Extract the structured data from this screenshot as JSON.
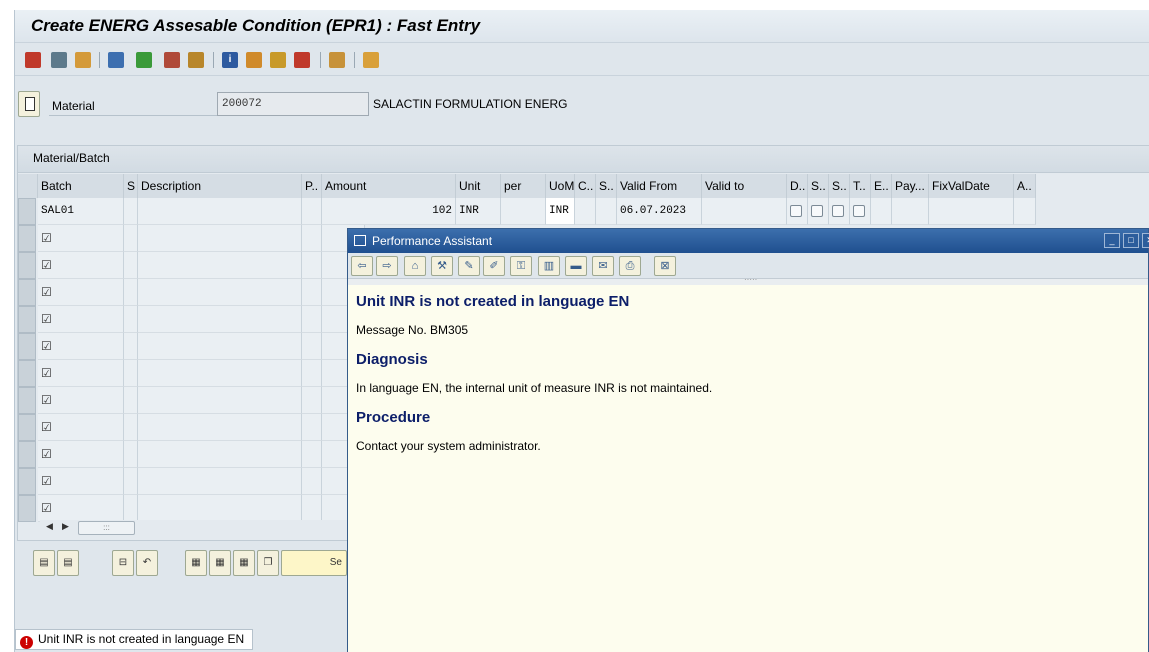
{
  "window": {
    "title": "Create ENERG Assesable Condition (EPR1) : Fast Entry"
  },
  "toolbar": {
    "icons": [
      "print-icon",
      "find-icon",
      "find-next-icon",
      "copy-icon",
      "execute-icon",
      "select-icon",
      "gift-icon",
      "info-icon",
      "hierarchy-icon",
      "key-icon",
      "delete-icon",
      "user-icon",
      "page-icon"
    ]
  },
  "header": {
    "material_label": "Material",
    "material_value": "200072",
    "material_description": "SALACTIN FORMULATION ENERG"
  },
  "table": {
    "section_title": "Material/Batch",
    "columns": [
      "Batch",
      "S",
      "Description",
      "P..",
      "Amount",
      "Unit",
      "per",
      "UoM",
      "C..",
      "S..",
      "Valid From",
      "Valid to",
      "D..",
      "S..",
      "S..",
      "T..",
      "E..",
      "Pay...",
      "FixValDate",
      "A.."
    ],
    "rows": [
      {
        "batch": "SAL01",
        "amount": "102",
        "unit": "INR",
        "uom": "INR",
        "valid_from": "06.07.2023"
      }
    ],
    "check_symbol": "☑"
  },
  "bottom_toolbar": {
    "partial_button_label": "Se"
  },
  "status": {
    "message": "Unit INR is not created in language EN",
    "error_symbol": "!"
  },
  "performance_assistant": {
    "title": "Performance Assistant",
    "heading": "Unit INR is not created in language EN",
    "message_no": "Message No. BM305",
    "diagnosis_heading": "Diagnosis",
    "diagnosis_text": "In language EN, the internal unit of measure INR is not maintained.",
    "procedure_heading": "Procedure",
    "procedure_text": "Contact your system administrator."
  }
}
